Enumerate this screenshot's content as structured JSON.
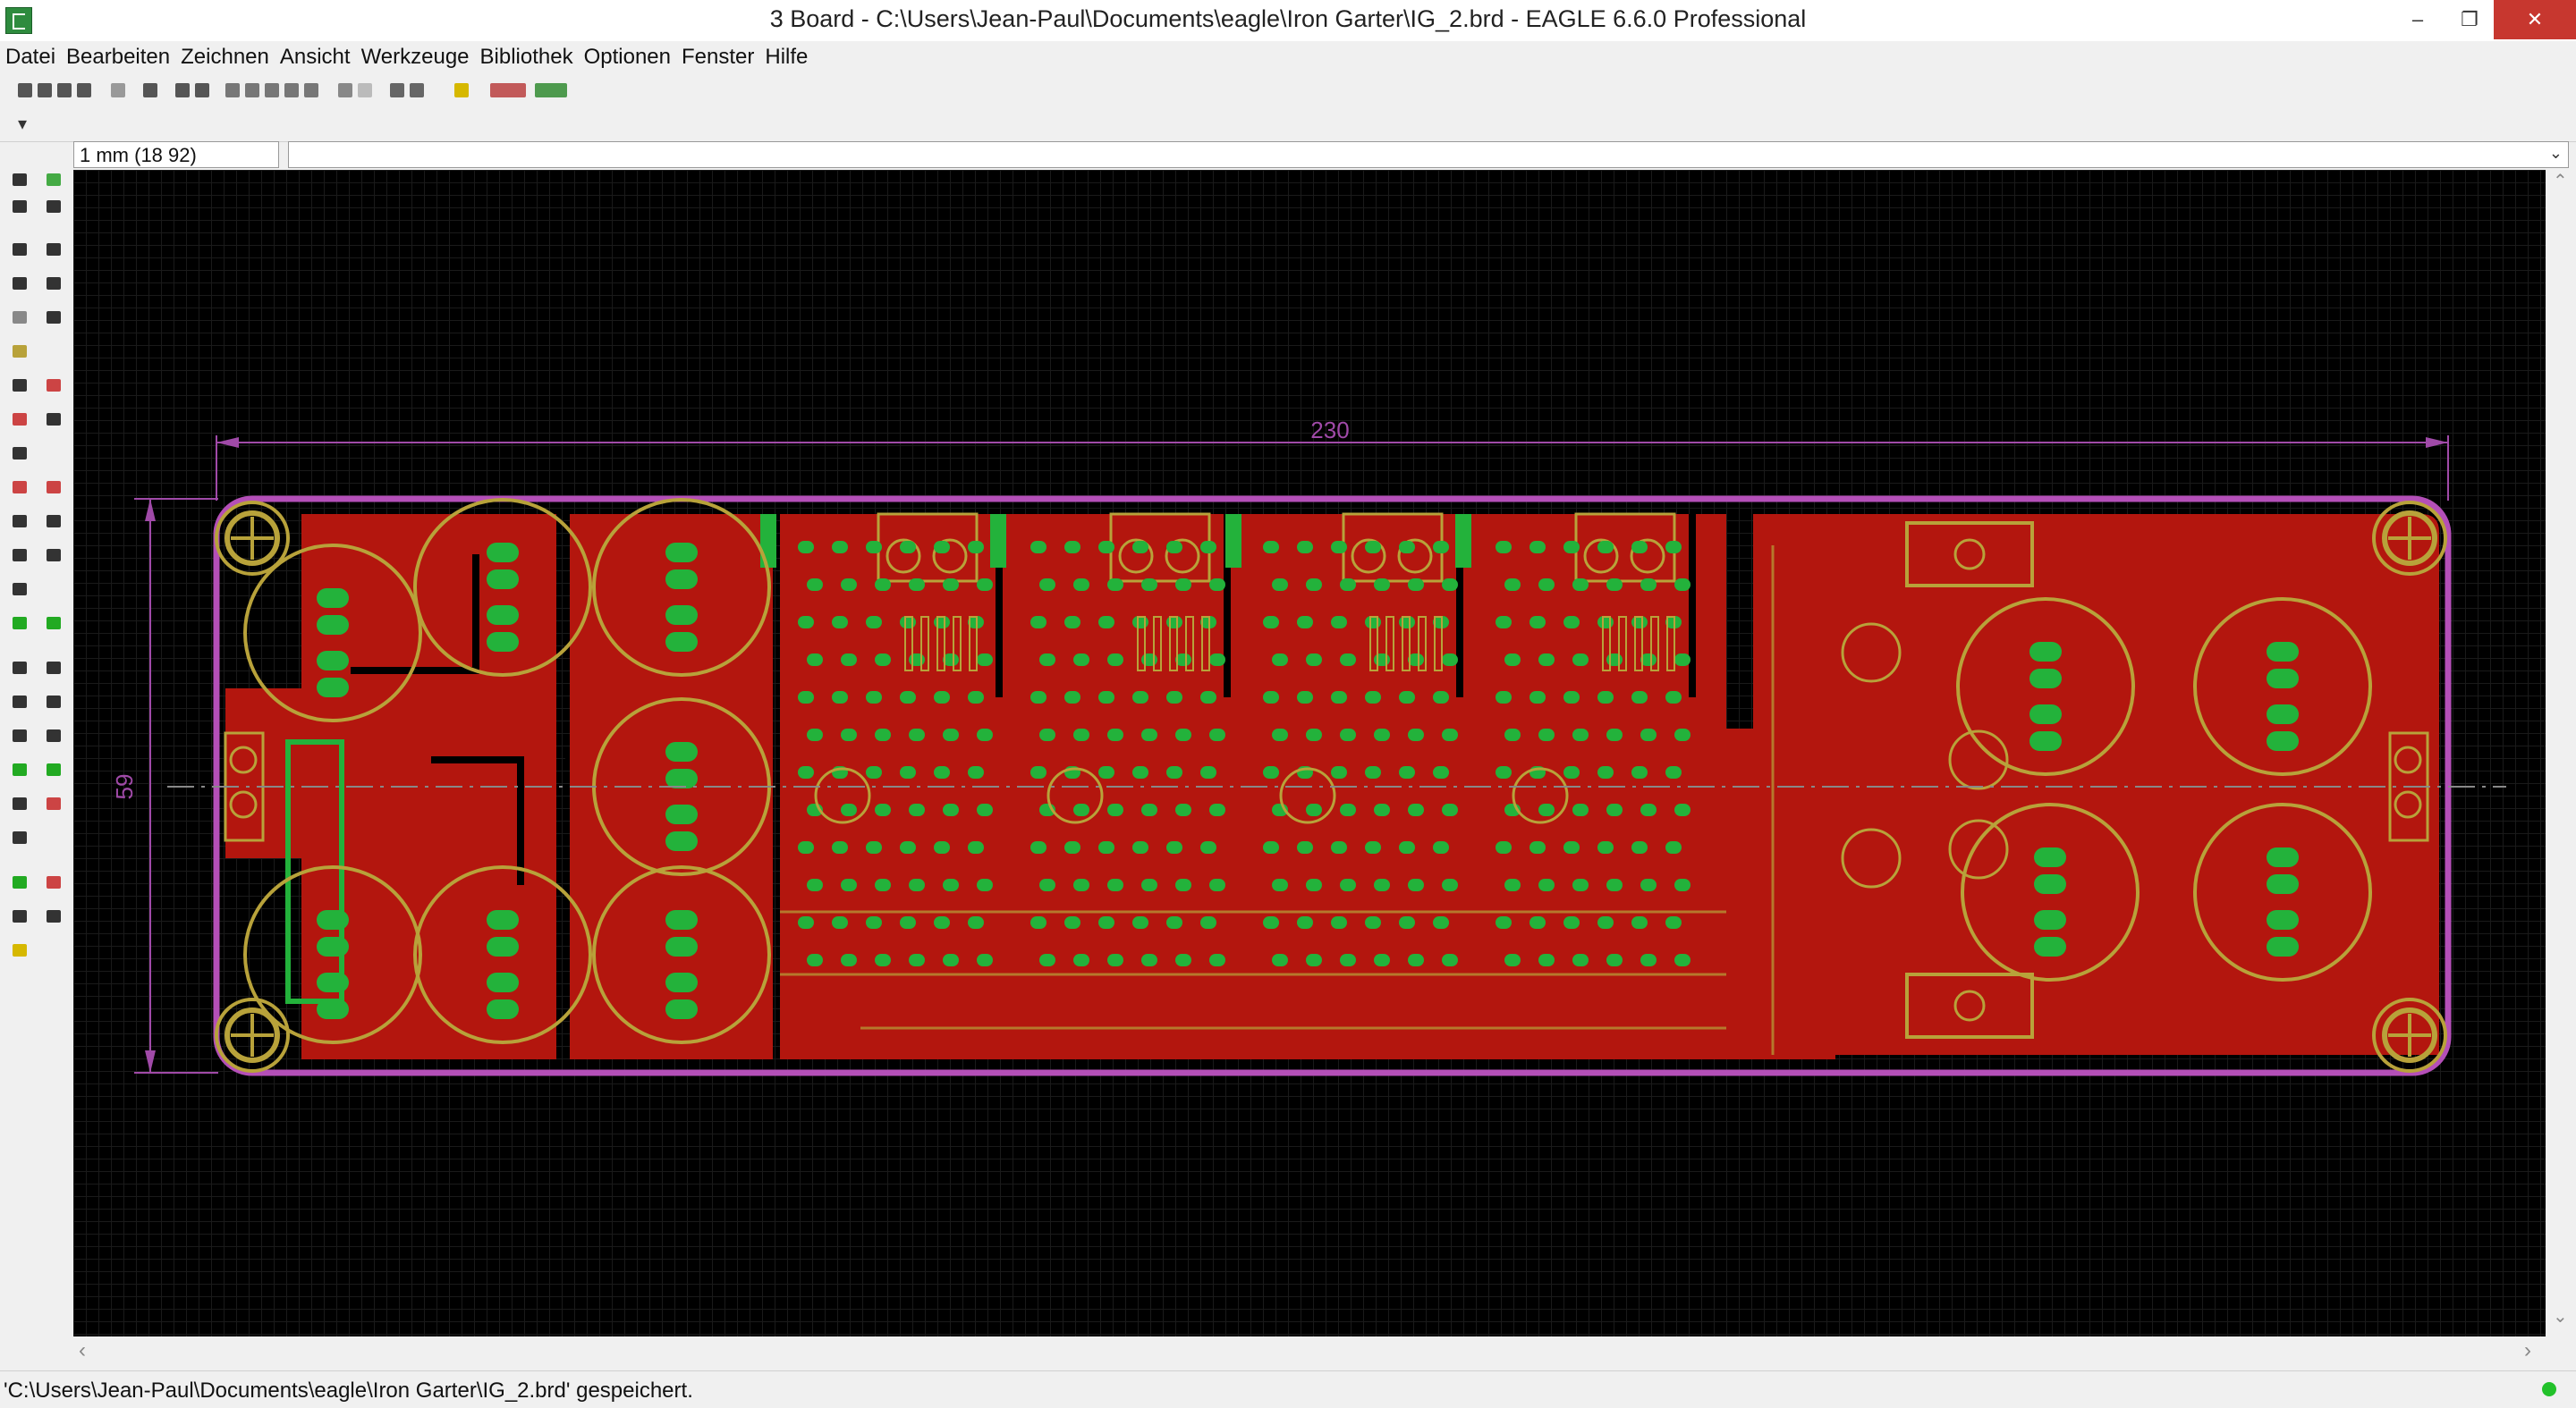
{
  "window": {
    "title": "3 Board - C:\\Users\\Jean-Paul\\Documents\\eagle\\Iron Garter\\IG_2.brd - EAGLE 6.6.0 Professional",
    "minimize_glyph": "–",
    "restore_glyph": "❐",
    "close_glyph": "✕"
  },
  "menu": {
    "items": [
      "Datei",
      "Bearbeiten",
      "Zeichnen",
      "Ansicht",
      "Werkzeuge",
      "Bibliothek",
      "Optionen",
      "Fenster",
      "Hilfe"
    ]
  },
  "toolbar": {
    "more_glyph": "▾"
  },
  "coords": {
    "grid_value": "1 mm (18 92)"
  },
  "command": {
    "value": "",
    "dropdown_glyph": "⌄"
  },
  "board": {
    "width_dimension": "230",
    "height_dimension": "59"
  },
  "scrollbar": {
    "up": "⌃",
    "down": "⌄",
    "left": "‹",
    "right": "›"
  },
  "status": {
    "message": "'C:\\Users\\Jean-Paul\\Documents\\eagle\\Iron Garter\\IG_2.brd' gespeichert."
  },
  "colors": {
    "canvas_bg": "#000000",
    "copper_top": "#b3160e",
    "pad": "#23b23b",
    "silk": "#b8a23a",
    "outline": "#b44fb8",
    "dimension": "#a04aa8",
    "title_close": "#c7372f"
  }
}
